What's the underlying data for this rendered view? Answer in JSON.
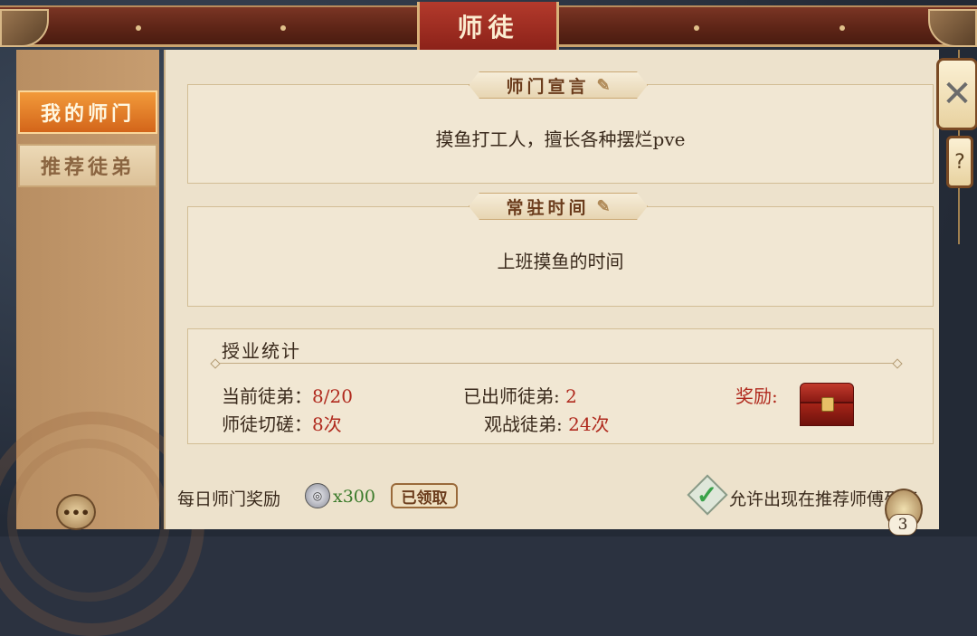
{
  "header": {
    "title": "师徒"
  },
  "sidebar": {
    "tabs": [
      {
        "label": "我的师门",
        "active": true
      },
      {
        "label": "推荐徒弟",
        "active": false
      }
    ]
  },
  "declaration": {
    "heading": "师门宣言",
    "text": "摸鱼打工人，擅长各种摆烂pve"
  },
  "residence": {
    "heading": "常驻时间",
    "text": "上班摸鱼的时间"
  },
  "stats": {
    "title": "授业统计",
    "current_disciples_label": "当前徒弟：",
    "current_disciples_value": "8/20",
    "graduated_label": "已出师徒弟:",
    "graduated_value": "2",
    "sparring_label": "师徒切磋：",
    "sparring_value": "8次",
    "spectate_label": "观战徒弟:",
    "spectate_value": "24次",
    "reward_label": "奖励:"
  },
  "footer": {
    "daily_reward_label": "每日师门奖励",
    "coin_amount": "x300",
    "claimed_label": "已领取",
    "allow_recommend_label": "允许出现在推荐师傅列表",
    "allow_recommend_checked": true,
    "badge_count": "3"
  },
  "icons": {
    "close": "close-icon",
    "help": "?",
    "chat": "•••",
    "scroll": "scroll-icon",
    "check": "✓"
  },
  "colors": {
    "accent_red": "#b02a1e",
    "tab_active": "#e07a26",
    "parchment": "#ede2cc"
  }
}
